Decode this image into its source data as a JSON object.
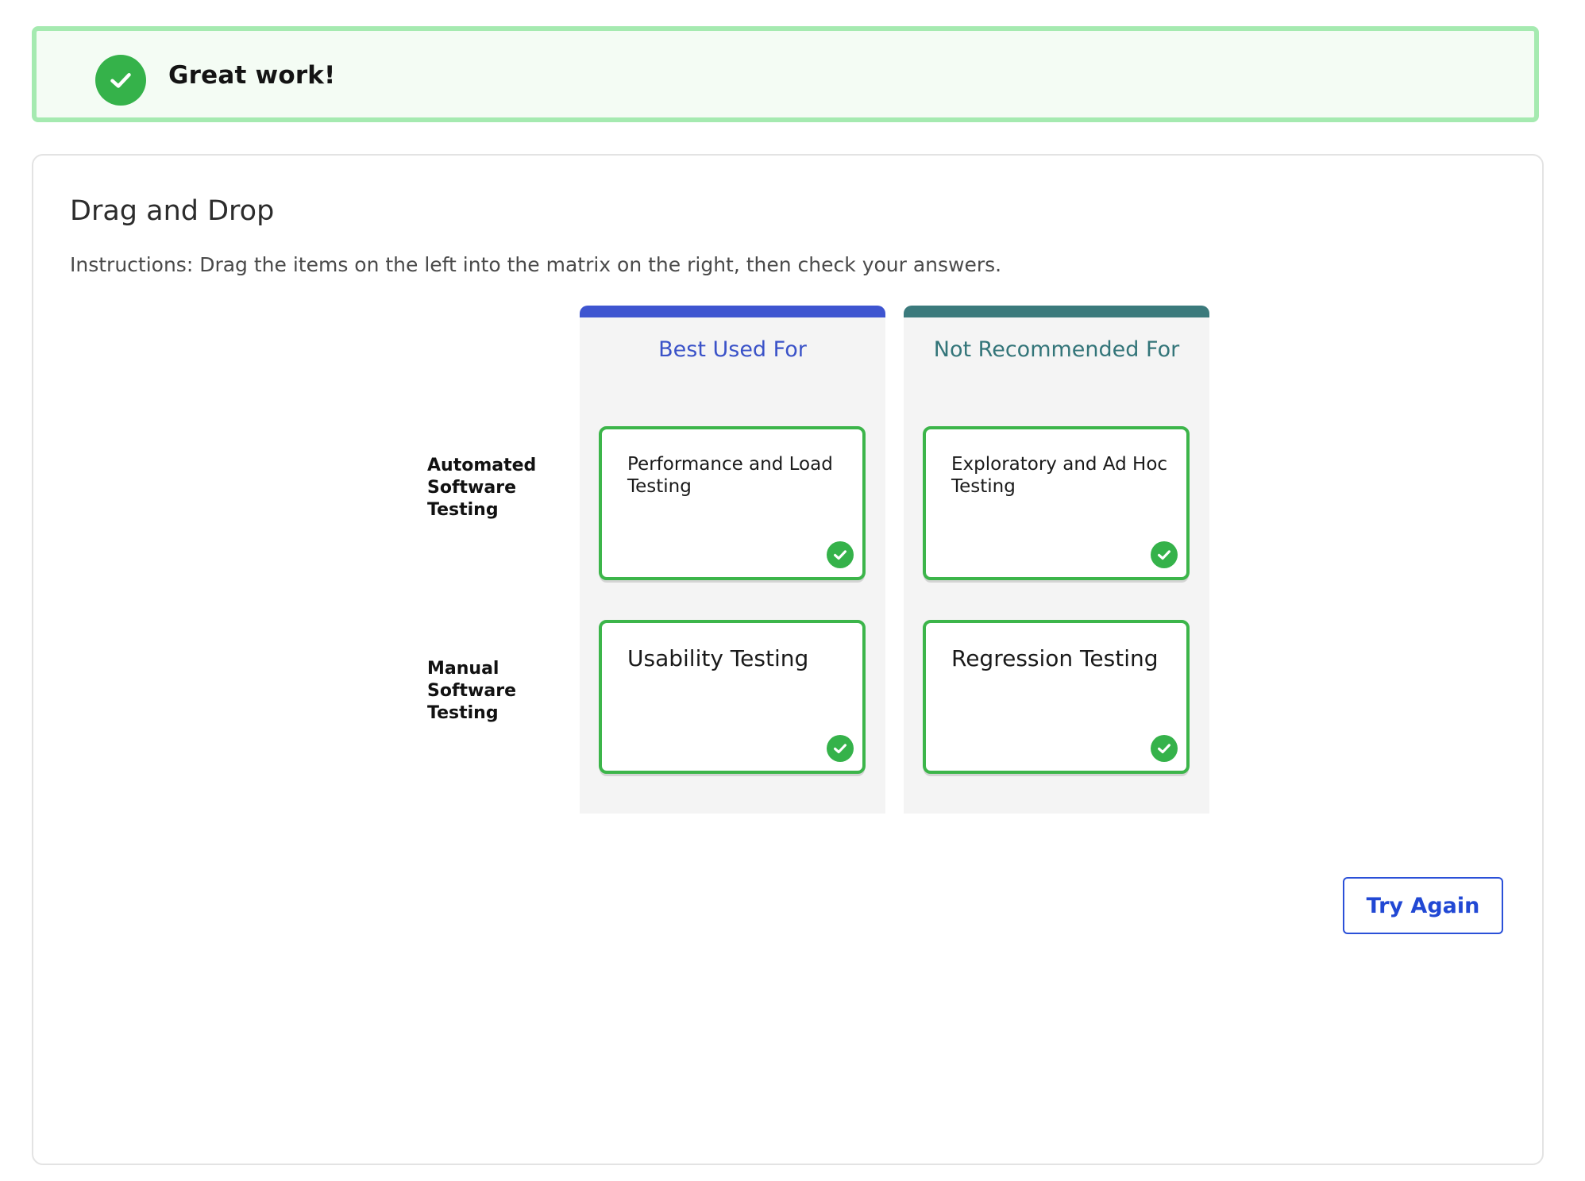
{
  "banner": {
    "message": "Great work!",
    "icon": "check-circle-icon",
    "border_color": "#a5eab0",
    "icon_color": "#35b24a"
  },
  "activity": {
    "title": "Drag and Drop",
    "instructions": "Instructions: Drag the items on the left into the matrix on the right, then check your answers."
  },
  "matrix": {
    "columns": [
      {
        "label": "Best Used For",
        "color": "#3e55d0"
      },
      {
        "label": "Not Recommended For",
        "color": "#3b7a7c"
      }
    ],
    "rows": [
      {
        "label": "Automated Software Testing"
      },
      {
        "label": "Manual Software Testing"
      }
    ],
    "cells": [
      [
        {
          "text": "Performance and Load Testing",
          "status": "correct",
          "icon": "check-circle-icon"
        },
        {
          "text": "Exploratory and Ad Hoc Testing",
          "status": "correct",
          "icon": "check-circle-icon"
        }
      ],
      [
        {
          "text": "Usability Testing",
          "status": "correct",
          "icon": "check-circle-icon"
        },
        {
          "text": "Regression Testing",
          "status": "correct",
          "icon": "check-circle-icon"
        }
      ]
    ],
    "correct_color": "#3cb54a"
  },
  "actions": {
    "try_again_label": "Try Again",
    "accent_color": "#2a50d8"
  }
}
